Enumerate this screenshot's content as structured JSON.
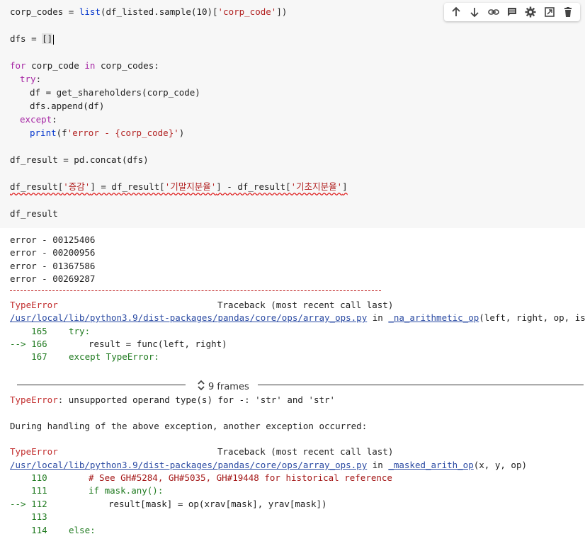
{
  "toolbar": {
    "icons": [
      "arrow-up-icon",
      "arrow-down-icon",
      "link-icon",
      "comment-icon",
      "gear-icon",
      "mirror-cell-icon",
      "trash-icon"
    ]
  },
  "code": {
    "l1_a": "corp_codes = ",
    "l1_b": "list",
    "l1_c": "(df_listed.sample(10)[",
    "l1_d": "'corp_code'",
    "l1_e": "])",
    "l2_a": "dfs = ",
    "l2_b": "[]",
    "l3_a": "for",
    "l3_b": " corp_code ",
    "l3_c": "in",
    "l3_d": " corp_codes:",
    "l4_a": "try",
    "l4_b": ":",
    "l5": "df = get_shareholders(corp_code)",
    "l6": "dfs.append(df)",
    "l7_a": "except",
    "l7_b": ":",
    "l8_a": "print",
    "l8_b": "(f",
    "l8_c": "'error - {corp_code}'",
    "l8_d": ")",
    "l9": "df_result = pd.concat(dfs)",
    "l10_a": "df_result[",
    "l10_b": "'증감'",
    "l10_c": "] = df_result[",
    "l10_d": "'기말지분율'",
    "l10_e": "] - df_result[",
    "l10_f": "'기초지분율'",
    "l10_g": "]",
    "l11": "df_result"
  },
  "output": {
    "errors": [
      "error - 00125406",
      "error - 00200956",
      "error - 01367586",
      "error - 00269287"
    ],
    "tb1_type": "TypeError",
    "tb1_header": "Traceback (most recent call last)",
    "tb1_path": "/usr/local/lib/python3.9/dist-packages/pandas/core/ops/array_ops.py",
    "tb1_in": " in ",
    "tb1_fn": "_na_arithmetic_op",
    "tb1_args": "(left, right, op, is_cmp)",
    "tb1_l165_no": "    165",
    "tb1_l165": "try:",
    "tb1_l166_no": "--> 166",
    "tb1_l166": "result = func(left, right)",
    "tb1_l167_no": "    167",
    "tb1_l167": "except TypeError:",
    "frames_label": "9 frames",
    "err_type": "TypeError",
    "err_msg": ": unsupported operand type(s) for -: 'str' and 'str'",
    "during": "During handling of the above exception, another exception occurred:",
    "tb2_type": "TypeError",
    "tb2_header": "Traceback (most recent call last)",
    "tb2_path": "/usr/local/lib/python3.9/dist-packages/pandas/core/ops/array_ops.py",
    "tb2_in": " in ",
    "tb2_fn": "_masked_arith_op",
    "tb2_args": "(x, y, op)",
    "tb2_l110_no": "    110",
    "tb2_l110": "# See GH#5284, GH#5035, GH#19448 for historical reference",
    "tb2_l111_no": "    111",
    "tb2_l111": "if mask.any():",
    "tb2_l112_no": "--> 112",
    "tb2_l112": "result[mask] = op(xrav[mask], yrav[mask])",
    "tb2_l113_no": "    113",
    "tb2_l114_no": "    114",
    "tb2_l114": "else:"
  }
}
